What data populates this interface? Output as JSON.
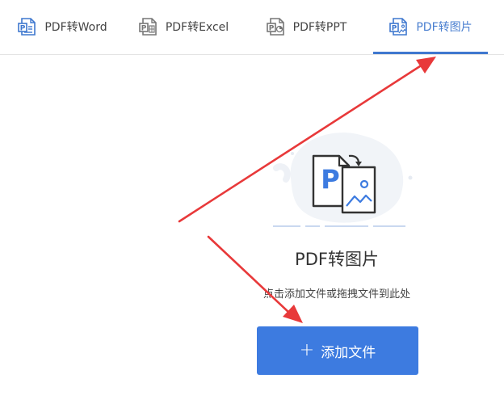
{
  "tabs": [
    {
      "label": "PDF转Word",
      "icon": "pdf-word-icon",
      "active": false
    },
    {
      "label": "PDF转Excel",
      "icon": "pdf-excel-icon",
      "active": false
    },
    {
      "label": "PDF转PPT",
      "icon": "pdf-ppt-icon",
      "active": false
    },
    {
      "label": "PDF转图片",
      "icon": "pdf-image-icon",
      "active": true
    }
  ],
  "illustration": {
    "badge_letter": "P",
    "icon": "pdf-to-image-icon"
  },
  "main": {
    "title": "PDF转图片",
    "subtitle": "点击添加文件或拖拽文件到此处",
    "add_button_label": "添加文件"
  },
  "colors": {
    "accent": "#3d7be0",
    "tab_active": "#4a7fd0",
    "annotation_arrow": "#e8393a"
  }
}
